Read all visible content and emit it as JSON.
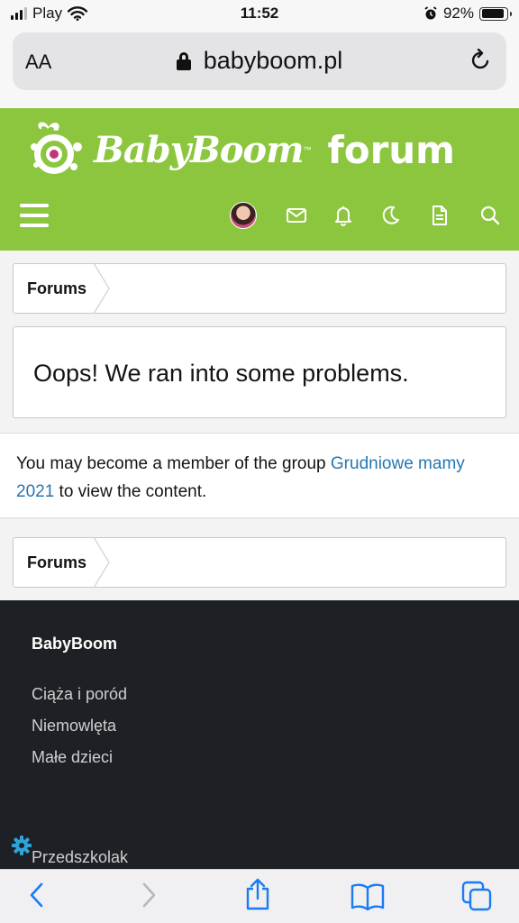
{
  "status_bar": {
    "carrier": "Play",
    "time": "11:52",
    "battery_percent": "92%",
    "battery_level": 0.92
  },
  "browser": {
    "text_size_button": "AA",
    "url": "babyboom.pl"
  },
  "site": {
    "brand": "BabyBoom",
    "forum_word": "forum",
    "accent_color": "#8cc63f"
  },
  "header_icons": [
    "menu-icon",
    "avatar",
    "mail-icon",
    "bell-icon",
    "moon-icon",
    "document-icon",
    "search-icon"
  ],
  "breadcrumb_top": {
    "label": "Forums"
  },
  "error": {
    "title": "Oops! We ran into some problems."
  },
  "message": {
    "before": "You may become a member of the group ",
    "link": "Grudniowe mamy 2021",
    "after": " to view the content."
  },
  "breadcrumb_bottom": {
    "label": "Forums"
  },
  "footer": {
    "title": "BabyBoom",
    "links": [
      "Ciąża i poród",
      "Niemowlęta",
      "Małe dzieci",
      "Przedszkolak"
    ]
  },
  "toolbar_icons": [
    "back-icon",
    "forward-icon",
    "share-icon",
    "bookmarks-icon",
    "tabs-icon"
  ]
}
